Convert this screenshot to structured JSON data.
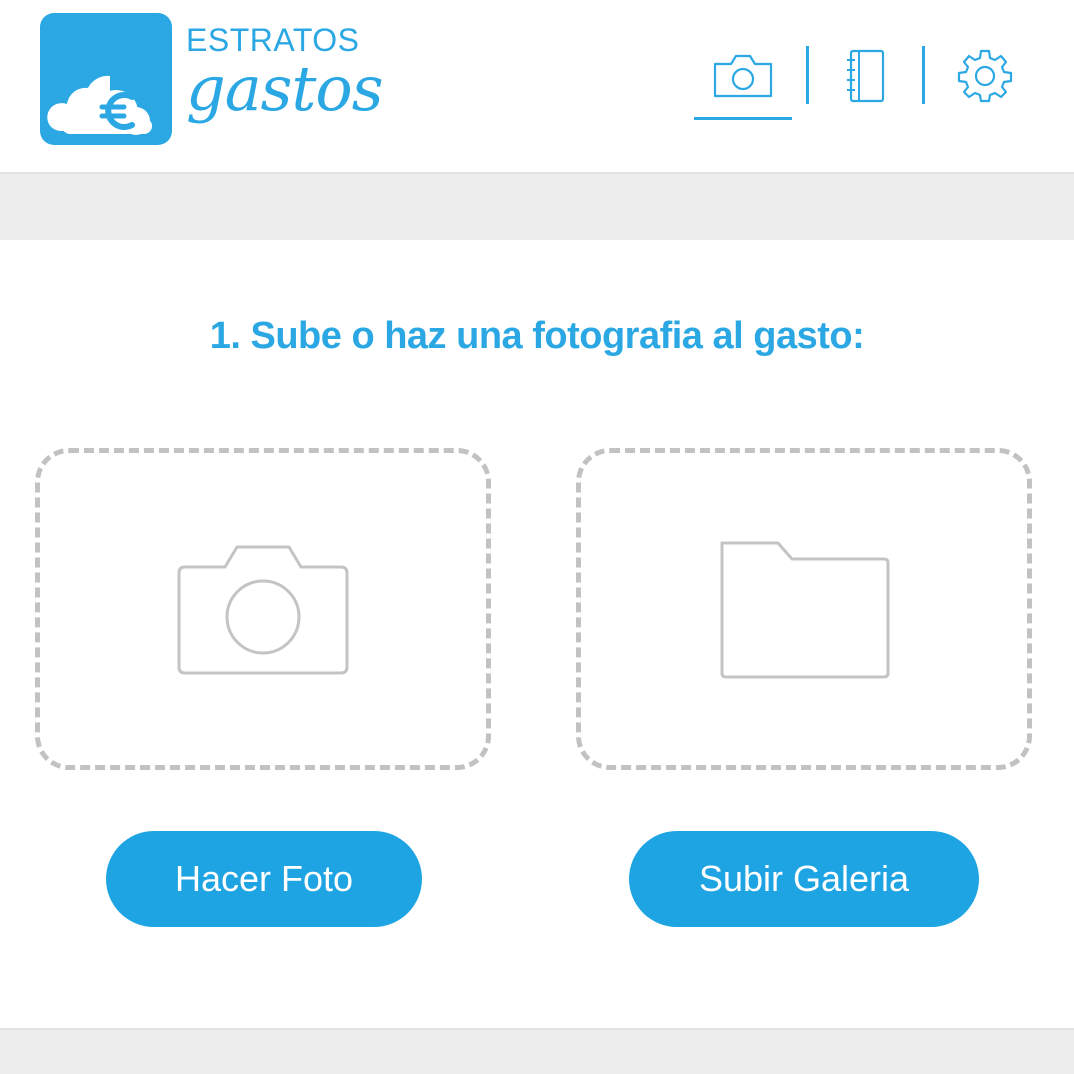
{
  "app": {
    "brand_top": "ESTRATOS",
    "brand_bottom": "gastos",
    "logo_icon": "cloud-euro-icon",
    "accent_color": "#2ba8e4"
  },
  "nav": {
    "tabs": [
      {
        "icon": "camera-icon",
        "active": true
      },
      {
        "icon": "notebook-icon",
        "active": false
      },
      {
        "icon": "gear-icon",
        "active": false
      }
    ]
  },
  "main": {
    "step_title": "1. Sube o haz una fotografia al gasto:",
    "options": [
      {
        "icon": "camera-icon",
        "button_label": "Hacer Foto"
      },
      {
        "icon": "folder-icon",
        "button_label": "Subir Galeria"
      }
    ]
  }
}
